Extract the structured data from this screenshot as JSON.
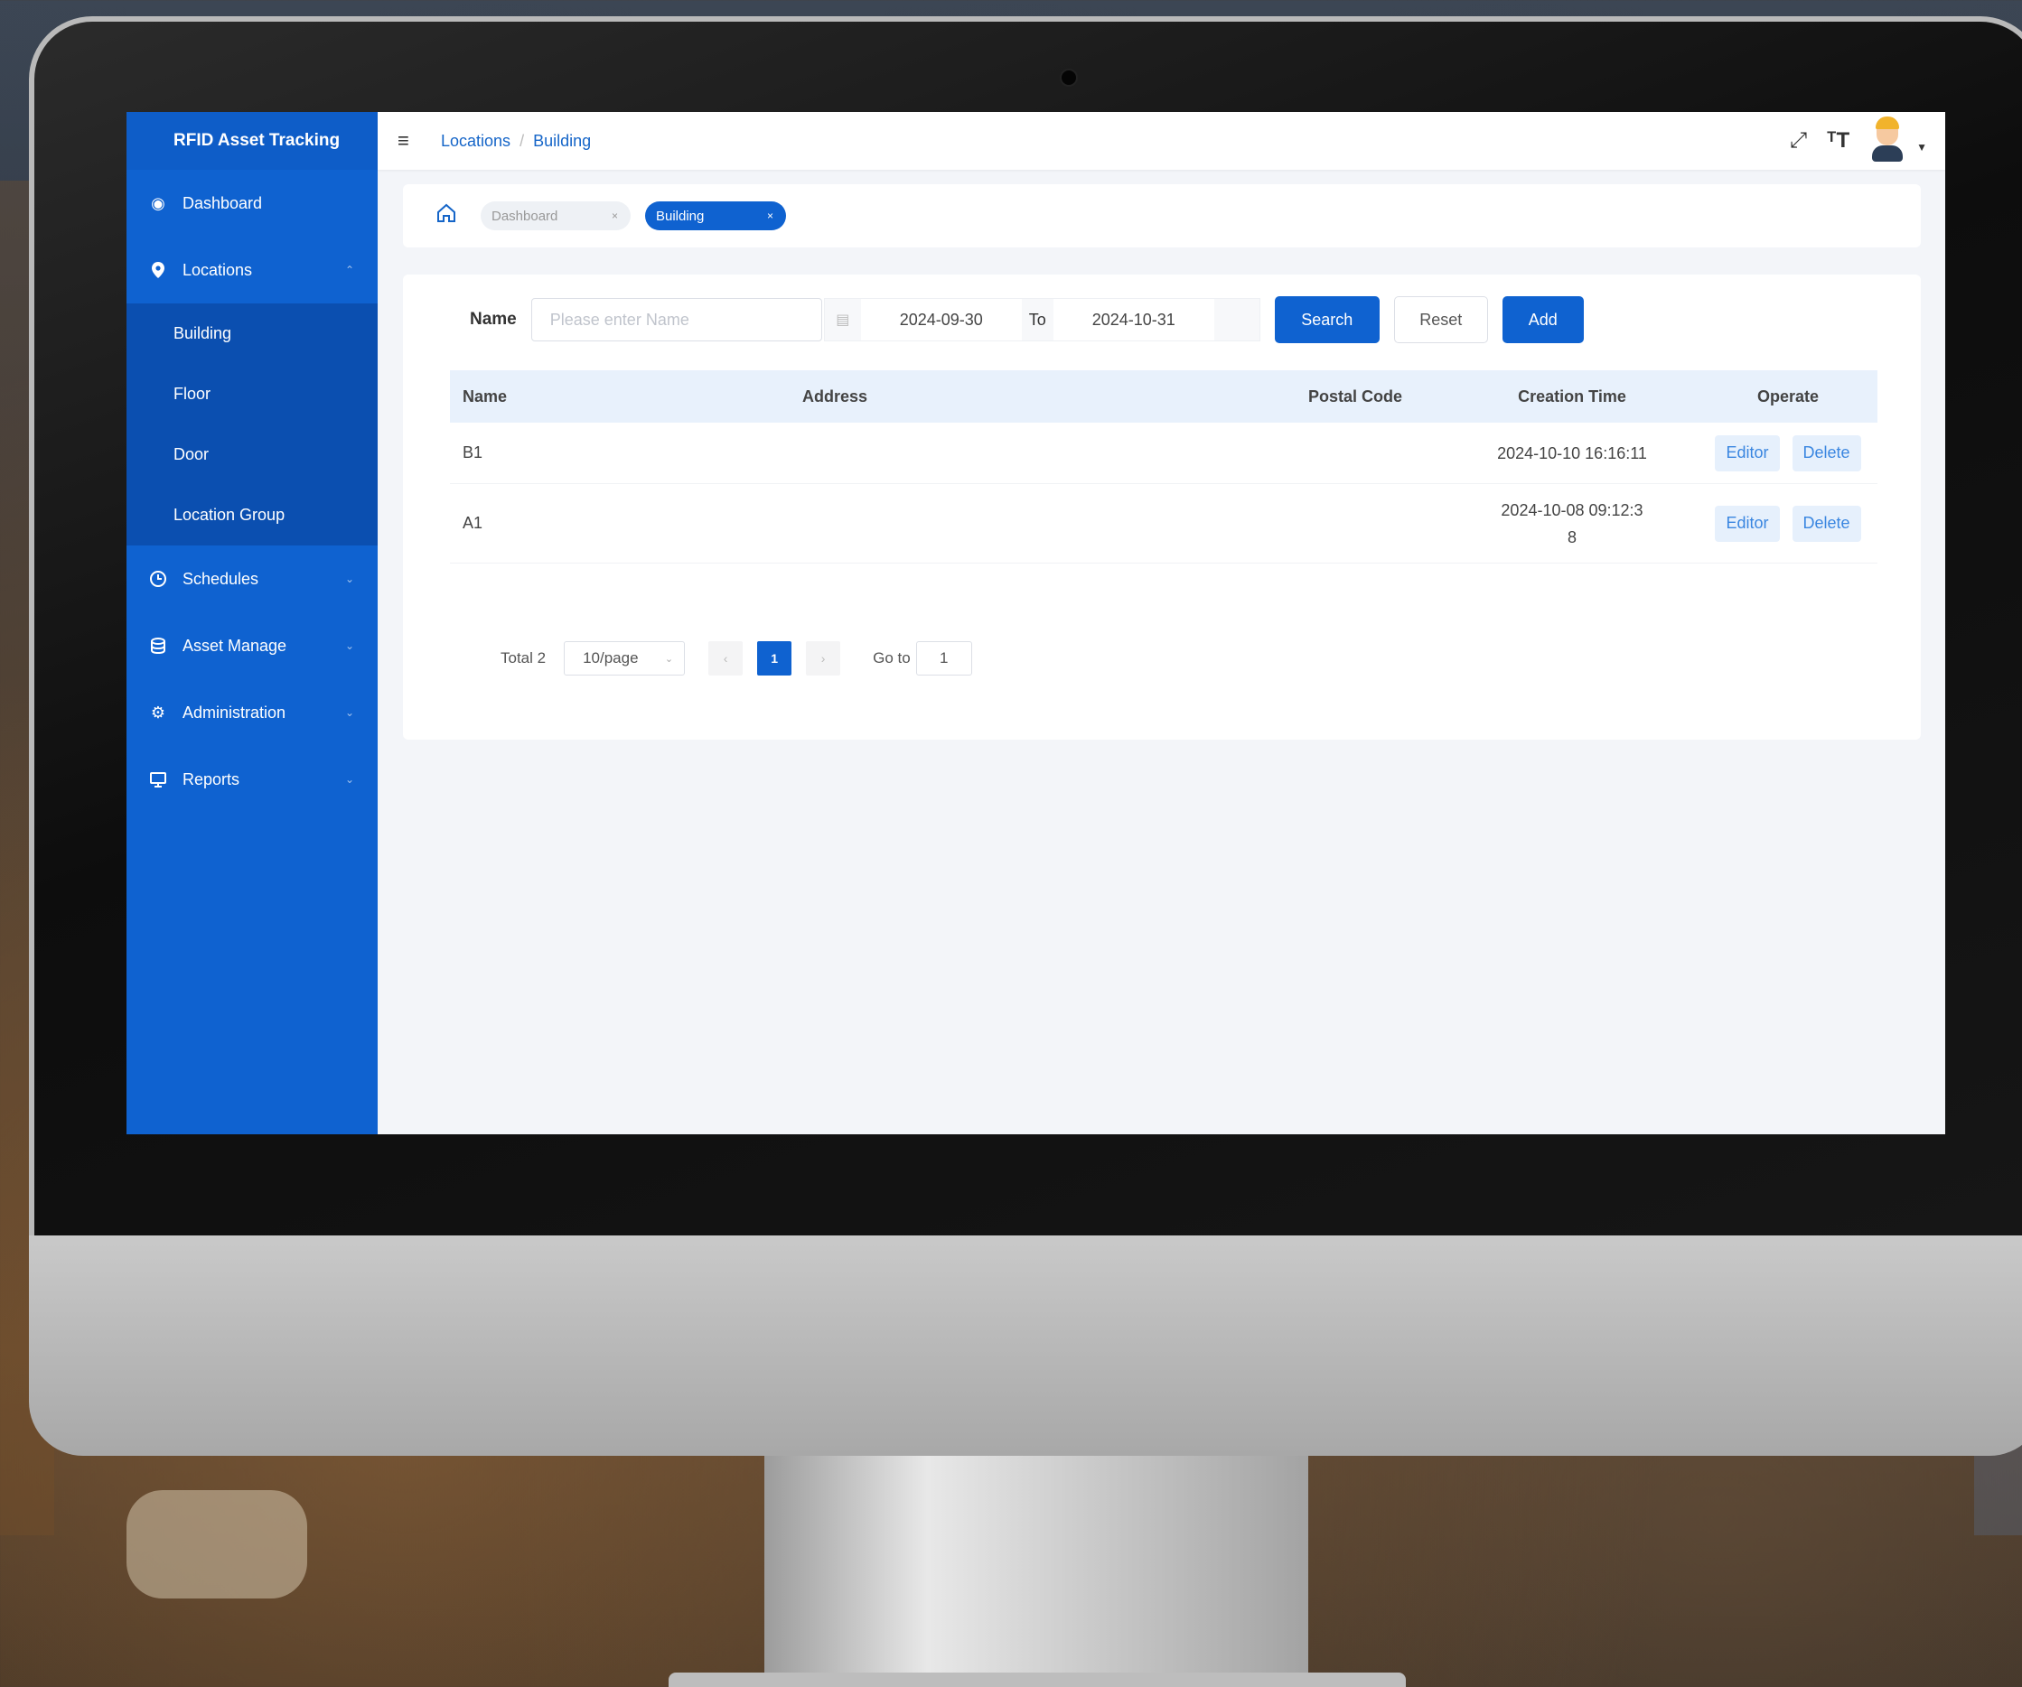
{
  "app": {
    "title": "RFID Asset Tracking"
  },
  "sidebar": {
    "items": [
      {
        "label": "Dashboard",
        "icon": "dashboard-icon"
      },
      {
        "label": "Locations",
        "icon": "location-pin-icon",
        "expanded": true,
        "children": [
          "Building",
          "Floor",
          "Door",
          "Location Group"
        ]
      },
      {
        "label": "Schedules",
        "icon": "clock-icon"
      },
      {
        "label": "Asset Manage",
        "icon": "database-icon"
      },
      {
        "label": "Administration",
        "icon": "gear-icon"
      },
      {
        "label": "Reports",
        "icon": "monitor-icon"
      }
    ]
  },
  "header": {
    "breadcrumb": [
      "Locations",
      "Building"
    ],
    "separator": "/",
    "tools": [
      "fullscreen-icon",
      "font-size-icon",
      "avatar"
    ]
  },
  "tags": [
    {
      "label": "Dashboard",
      "active": false
    },
    {
      "label": "Building",
      "active": true
    }
  ],
  "filters": {
    "name_label": "Name",
    "name_placeholder": "Please enter Name",
    "date_from": "2024-09-30",
    "date_to_label": "To",
    "date_to": "2024-10-31",
    "search_label": "Search",
    "reset_label": "Reset",
    "add_label": "Add"
  },
  "table": {
    "columns": [
      "Name",
      "Address",
      "Postal Code",
      "Creation Time",
      "Operate"
    ],
    "rows": [
      {
        "name": "B1",
        "address": "",
        "postal_code": "",
        "creation_time": "2024-10-10 16:16:11",
        "actions": [
          "Editor",
          "Delete"
        ]
      },
      {
        "name": "A1",
        "address": "",
        "postal_code": "",
        "creation_time": "2024-10-08 09:12:38",
        "actions": [
          "Editor",
          "Delete"
        ]
      }
    ]
  },
  "pagination": {
    "total_label": "Total 2",
    "page_size": "10/page",
    "current_page": "1",
    "goto_label": "Go to",
    "goto_value": "1"
  },
  "colors": {
    "brand": "#0f62d0",
    "sidebar": "#0f62d0",
    "submenu": "#0b4fb0",
    "table_header": "#e8f1fc"
  }
}
